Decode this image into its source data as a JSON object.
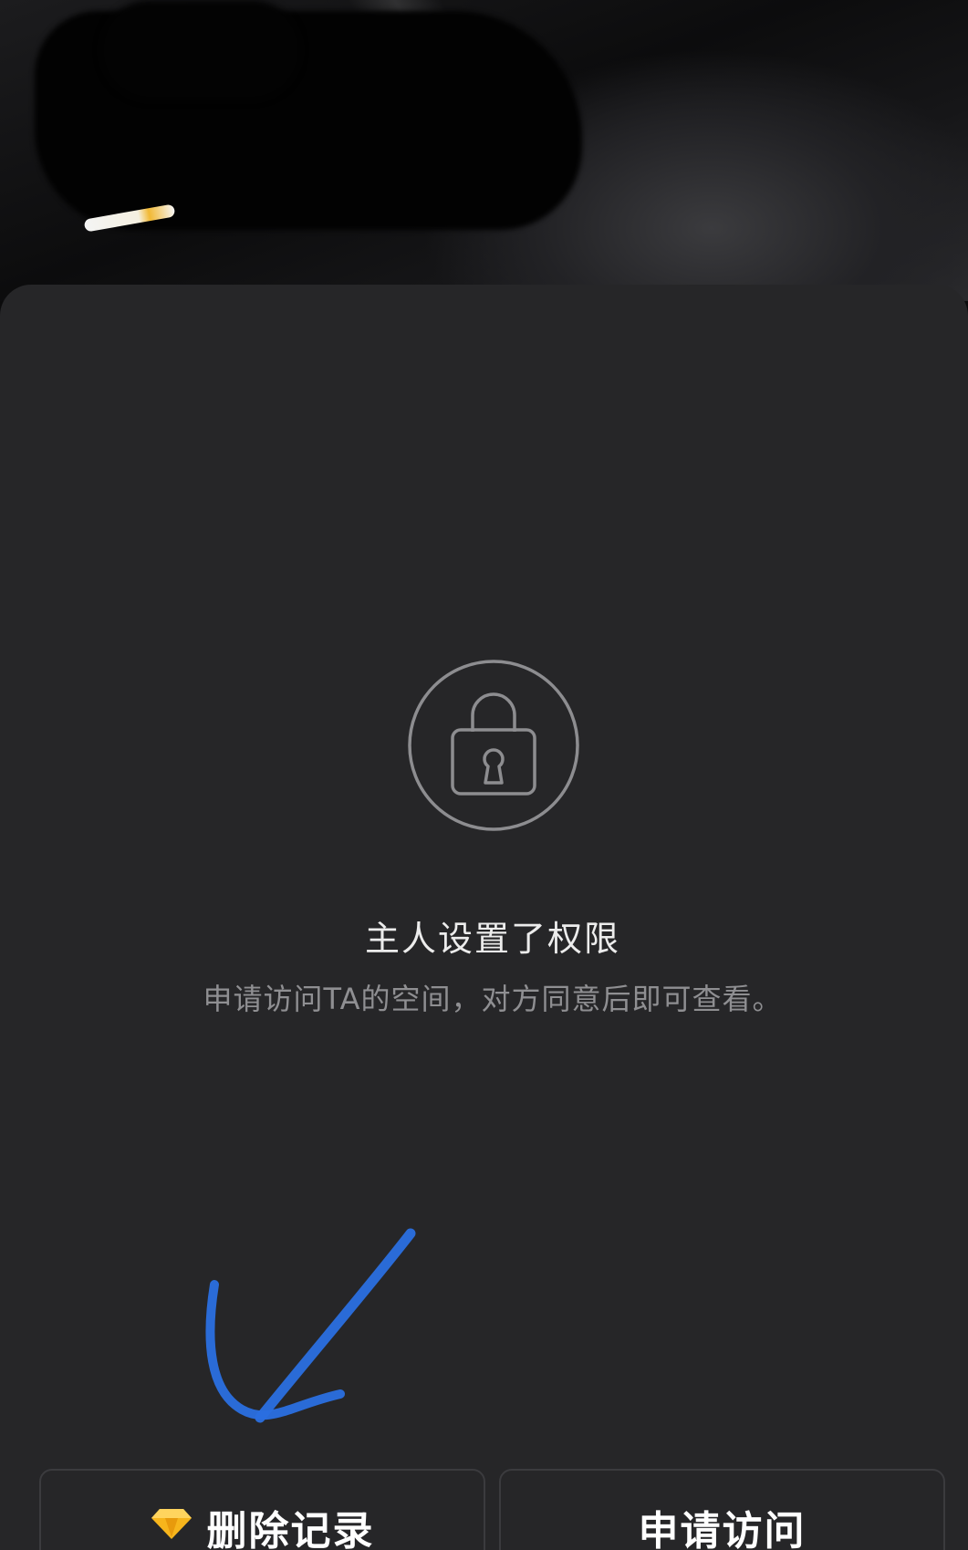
{
  "header": {
    "cover_label": "Profile cover photo (obscured)"
  },
  "locked_state": {
    "icon": "lock-icon",
    "title": "主人设置了权限",
    "subtitle": "申请访问TA的空间，对方同意后即可查看。"
  },
  "annotation": {
    "arrow_color": "#2a6fe0"
  },
  "actions": {
    "delete_icon": "diamond-icon",
    "delete_label": "删除记录",
    "request_label": "申请访问"
  },
  "colors": {
    "sheet_background": "#262628",
    "title_text": "#ececec",
    "subtitle_text": "#8f8f92",
    "diamond": "#f7b51c"
  }
}
